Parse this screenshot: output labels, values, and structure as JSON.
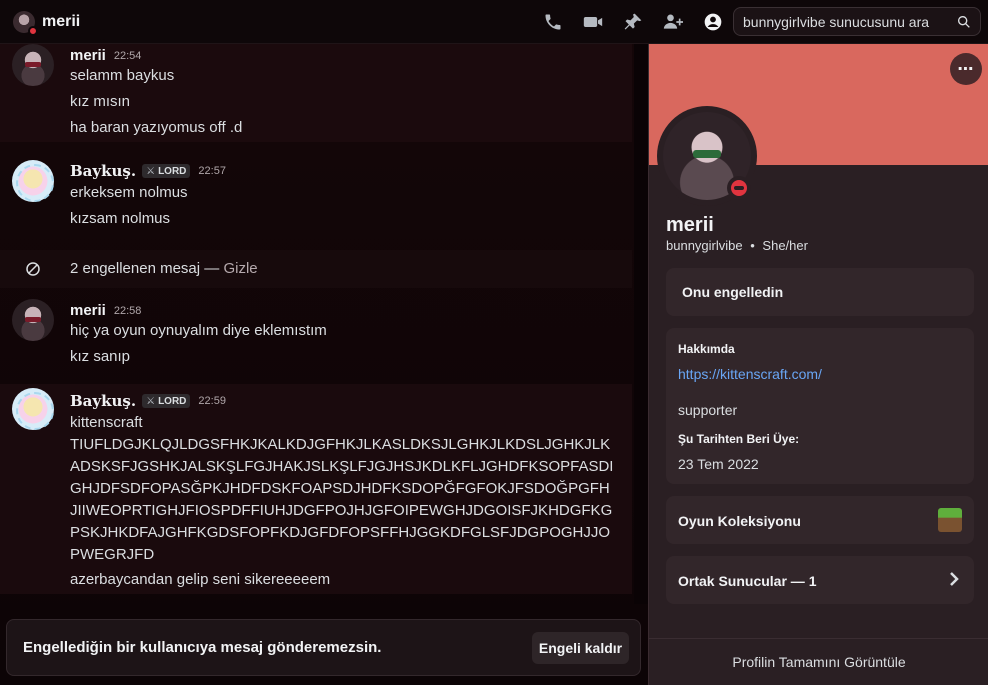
{
  "header": {
    "channel_name": "merii",
    "search_placeholder": "bunnygirlvibe sunucusunu ara",
    "icons": [
      "phone-call-icon",
      "video-camera-icon",
      "pin-icon",
      "add-friend-icon",
      "user-profile-icon",
      "search-icon"
    ]
  },
  "messages": [
    {
      "author": "merii",
      "time": "22:54",
      "lines": [
        "selamm baykus",
        "kız mısın",
        "ha baran yazıyomus off .d"
      ]
    },
    {
      "author": "Baykuş.",
      "tag": "LORD",
      "time": "22:57",
      "lines": [
        "erkeksem nolmus",
        "kızsam nolmus"
      ]
    },
    {
      "blocked_text": "2 engellenen mesaj — ",
      "blocked_hide": "Gizle"
    },
    {
      "author": "merii",
      "time": "22:58",
      "lines": [
        "hiç ya oyun oynuyalım diye eklemıstım",
        "kız sanıp"
      ]
    },
    {
      "author": "Baykuş.",
      "tag": "LORD",
      "time": "22:59",
      "first": "kittenscraft",
      "long": "TIUFLDGJKLQJLDGSFHKJKALKDJGFHKJLKASLDKSJLGHKJLKDSLJGHKJLKADSKSFJGSHKJALSKŞLFGJHAKJSLKŞLFJGJHSJKDLKFLJGHDFKSOPFASDIGHJDFSDFOPASĞPKJHDFDSKFOAPSDJHDFKSDOPĞFGFOKJFSDOĞPGFHJIIWEOPRTIGHJFIOSPDFFIUHJDGFPOJHJGFOIPEWGHJDGOISFJKHDGFKGPSKJHKDFAJGHFKGDSFOPFKDJGFDFOPSFFHJGGKDFGLSFJDGPOGHJJOPWEGRJFD",
      "last": "azerbaycandan gelip seni sikereeeeem"
    }
  ],
  "composer": {
    "notice": "Engellediğin bir kullanıcıya mesaj gönderemezsin.",
    "unblock_label": "Engeli kaldır"
  },
  "profile": {
    "banner_color": "#d9685e",
    "display_name": "merii",
    "username": "bunnygirlvibe",
    "pronouns": "She/her",
    "separator": "•",
    "blocked_label": "Onu engelledin",
    "about_heading": "Hakkımda",
    "about_link": "https://kittenscraft.com/",
    "about_text": "supporter",
    "member_since_heading": "Şu Tarihten Beri Üye:",
    "member_since": "23 Tem 2022",
    "games_label": "Oyun Koleksiyonu",
    "mutual_servers_label": "Ortak Sunucular — 1",
    "view_full_profile": "Profilin Tamamını Görüntüle"
  }
}
